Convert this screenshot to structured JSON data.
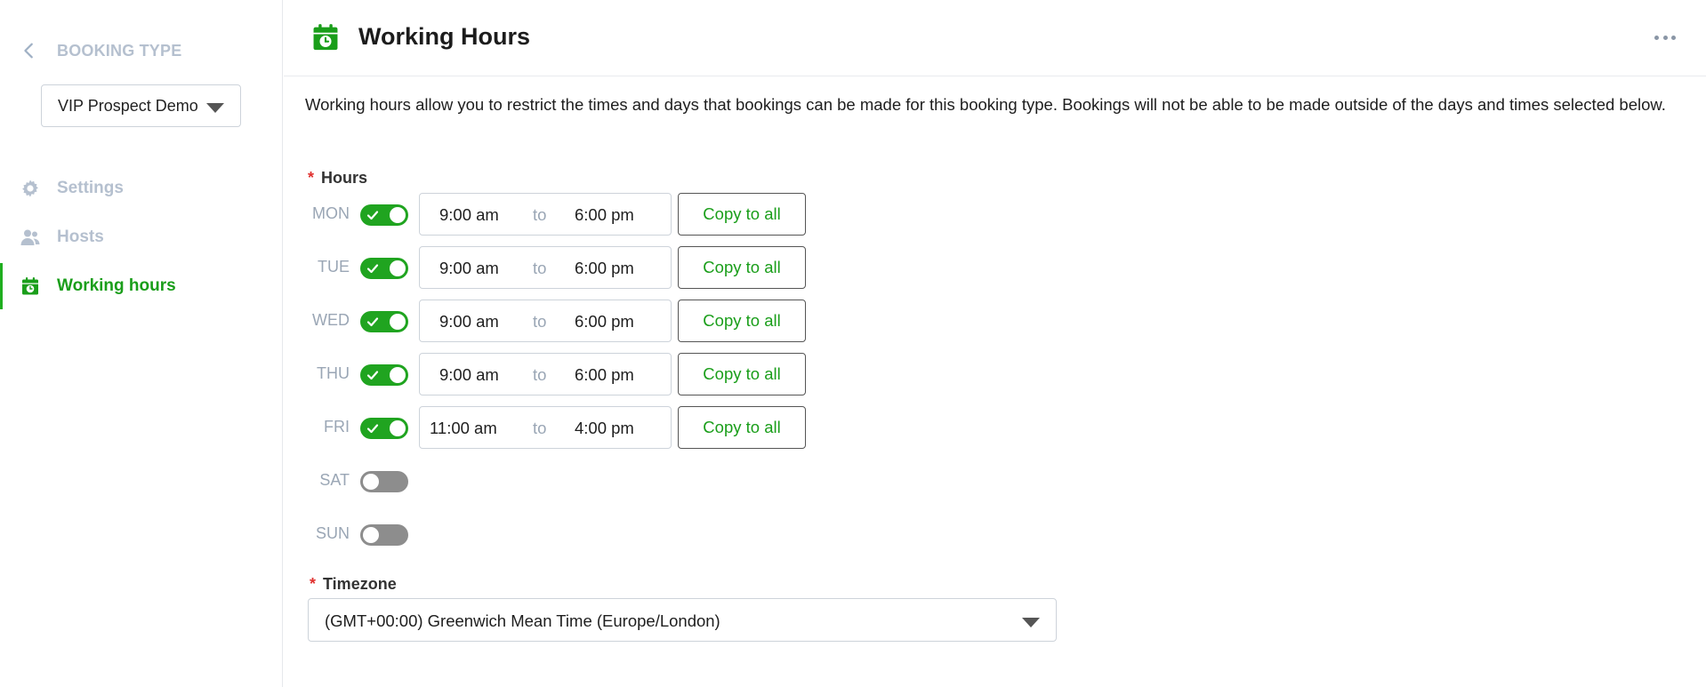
{
  "sidebar": {
    "back_label": "BOOKING TYPE",
    "booking_select": "VIP Prospect Demo",
    "nav": [
      {
        "label": "Settings",
        "icon": "gear-icon"
      },
      {
        "label": "Hosts",
        "icon": "users-icon"
      },
      {
        "label": "Working hours",
        "icon": "calendar-clock-icon"
      }
    ]
  },
  "header": {
    "title": "Working Hours",
    "icon": "calendar-clock-icon",
    "menu_icon": "more-horizontal-icon"
  },
  "description": "Working hours allow you to restrict the times and days that bookings can be made for this booking type. Bookings will not be able to be made outside of the days and times selected below.",
  "hours": {
    "label": "Hours",
    "required": "*",
    "to_label": "to",
    "copy_label": "Copy to all",
    "days": [
      {
        "day": "MON",
        "enabled": true,
        "start": "9:00 am",
        "end": "6:00 pm"
      },
      {
        "day": "TUE",
        "enabled": true,
        "start": "9:00 am",
        "end": "6:00 pm"
      },
      {
        "day": "WED",
        "enabled": true,
        "start": "9:00 am",
        "end": "6:00 pm"
      },
      {
        "day": "THU",
        "enabled": true,
        "start": "9:00 am",
        "end": "6:00 pm"
      },
      {
        "day": "FRI",
        "enabled": true,
        "start": "11:00 am",
        "end": "4:00 pm"
      },
      {
        "day": "SAT",
        "enabled": false
      },
      {
        "day": "SUN",
        "enabled": false
      }
    ]
  },
  "timezone": {
    "label": "Timezone",
    "required": "*",
    "value": "(GMT+00:00) Greenwich Mean Time (Europe/London)"
  },
  "colors": {
    "accent": "#1a9e1a",
    "toggle_on": "#20a420",
    "toggle_off": "#8d8d8d",
    "muted": "#b5c0cf",
    "required": "#e0312f"
  }
}
